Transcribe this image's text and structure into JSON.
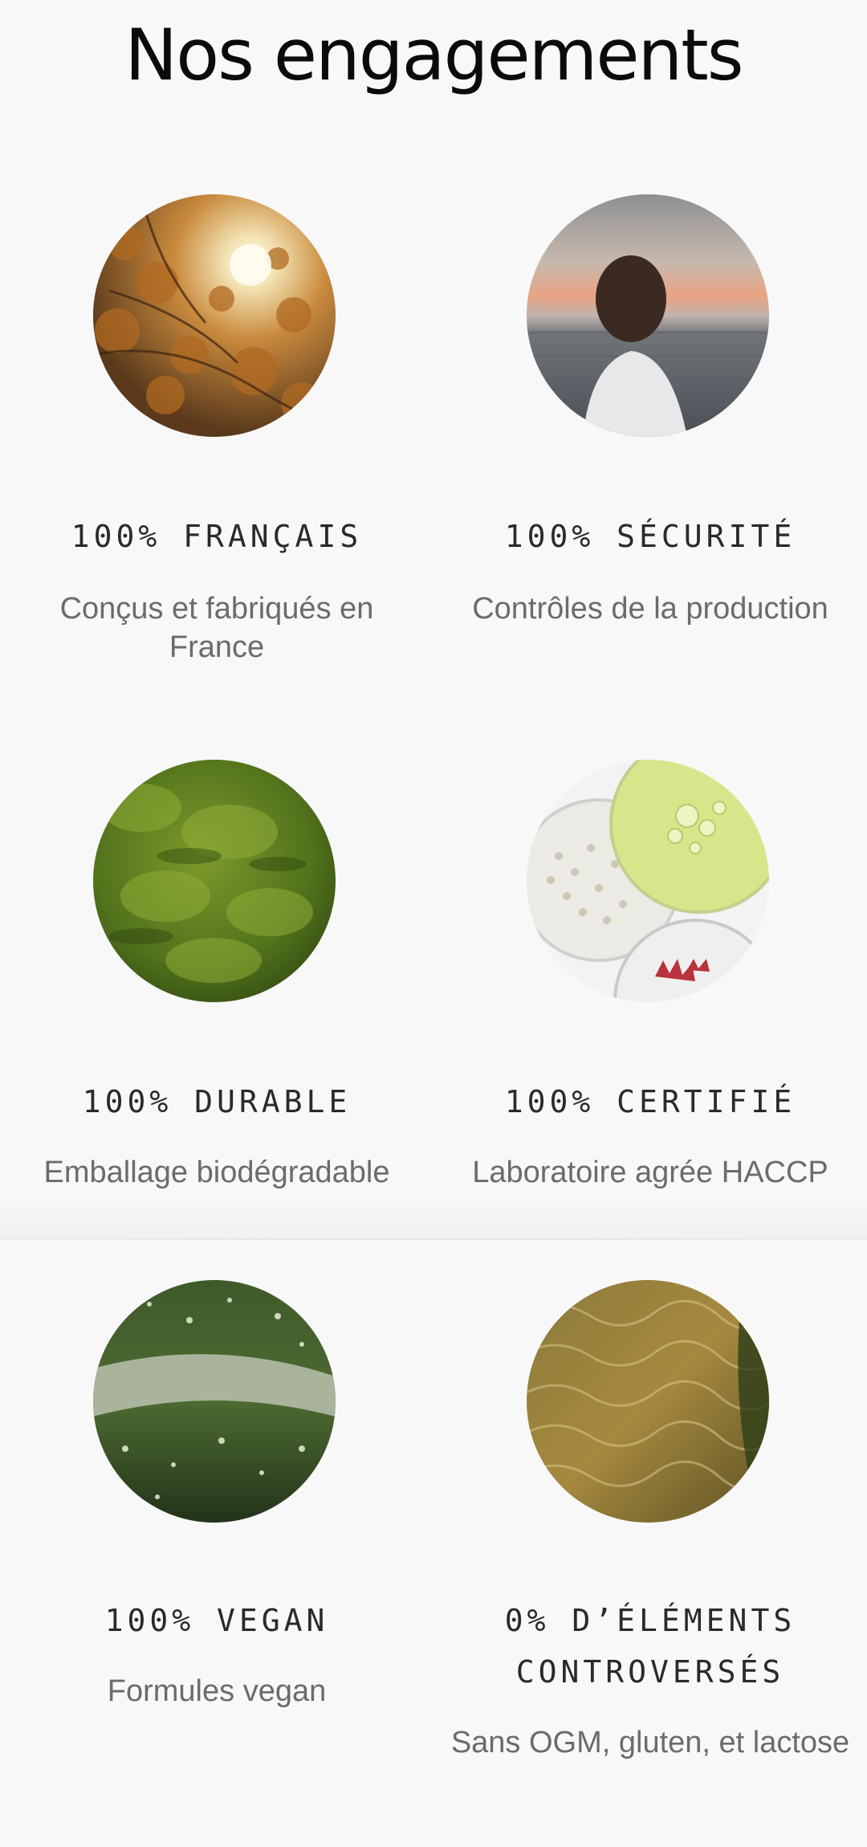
{
  "page": {
    "title": "Nos engagements"
  },
  "engagements": [
    {
      "label": "100% FRANÇAIS",
      "description": "Conçus et fabriqués en France",
      "image": "autumn-tree-sunlight-image"
    },
    {
      "label": "100% SÉCURITÉ",
      "description": "Contrôles de la production",
      "image": "person-by-the-sea-image"
    },
    {
      "label": "100% DURABLE",
      "description": "Emballage biodégradable",
      "image": "green-moss-image"
    },
    {
      "label": "100% CERTIFIÉ",
      "description": "Laboratoire agrée HACCP",
      "image": "petri-dishes-image"
    },
    {
      "label": "100% VEGAN",
      "description": "Formules vegan",
      "image": "green-foliage-image"
    },
    {
      "label_line1": "0% D’ÉLÉMENTS",
      "label_line2": "CONTROVERSÉS",
      "description": "Sans OGM, gluten, et lactose",
      "image": "water-ripples-image"
    }
  ],
  "colors": {
    "background": "#f8f8f9",
    "title": "#0b0b0b",
    "label": "#2a2a2a",
    "description": "#6b6b6b"
  }
}
